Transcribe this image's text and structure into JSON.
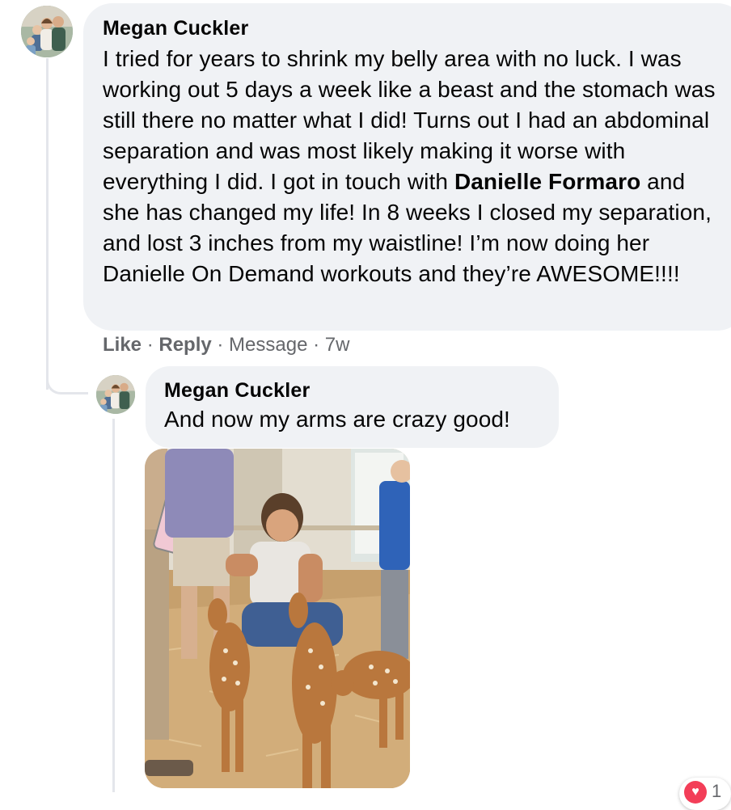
{
  "comment": {
    "author": "Megan Cuckler",
    "text_before_mention": "I tried for years to shrink my belly area with no luck. I was working out 5 days a week like a beast and the stomach was still there no matter what I did! Turns out I had an abdominal separation and was most likely making it worse with everything I did. I got in touch with ",
    "mention": "Danielle Formaro",
    "text_after_mention": " and she has changed my life! In 8 weeks I closed my separation, and lost 3 inches from my waistline! I’m now doing her Danielle On Demand workouts and they’re AWESOME!!!!",
    "actions": {
      "like": "Like",
      "reply": "Reply",
      "message": "Message",
      "time": "7w",
      "separator": " · "
    }
  },
  "reply": {
    "author": "Megan Cuckler",
    "text": "And now my arms are crazy good!",
    "reaction": {
      "icon": "heart-icon",
      "color": "#f33e58",
      "count": "1"
    }
  },
  "colors": {
    "bubble": "#f0f2f5",
    "secondary_text": "#65676b",
    "thread_line": "#e4e6eb"
  }
}
